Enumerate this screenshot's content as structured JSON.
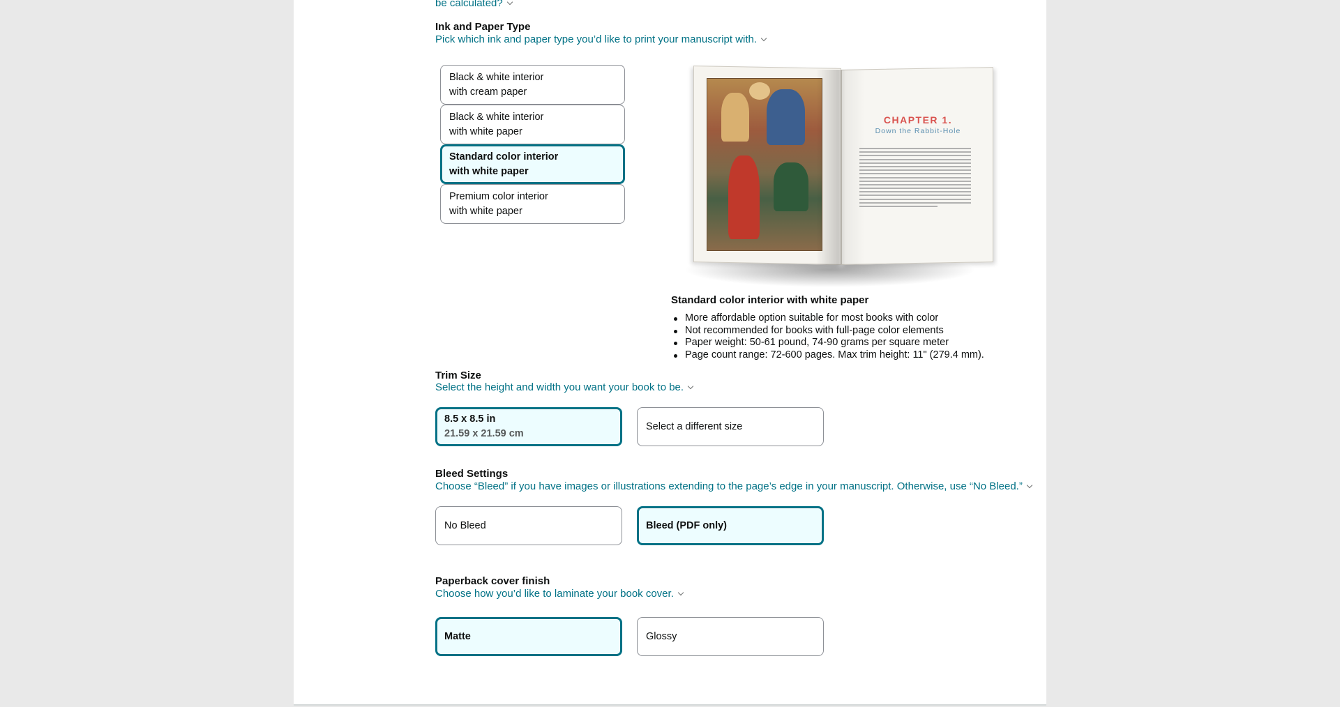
{
  "top_cut_link": "be calculated?",
  "ink_paper": {
    "title": "Ink and Paper Type",
    "description": "Pick which ink and paper type you’d like to print your manuscript with.",
    "options": [
      {
        "line1": "Black & white interior",
        "line2": "with cream paper",
        "selected": false
      },
      {
        "line1": "Black & white interior",
        "line2": "with white paper",
        "selected": false
      },
      {
        "line1": "Standard color interior",
        "line2": "with white paper",
        "selected": true
      },
      {
        "line1": "Premium color interior",
        "line2": "with white paper",
        "selected": false
      }
    ],
    "preview": {
      "chapter_title": "CHAPTER 1.",
      "chapter_subtitle": "Down the Rabbit-Hole"
    },
    "detail_title": "Standard color interior with white paper",
    "detail_bullets": [
      "More affordable option suitable for most books with color",
      "Not recommended for books with full-page color elements",
      "Paper weight: 50-61 pound, 74-90 grams per square meter",
      "Page count range: 72-600 pages. Max trim height: 11\" (279.4 mm)."
    ]
  },
  "trim_size": {
    "title": "Trim Size",
    "description": "Select the height and width you want your book to be.",
    "selected_option": {
      "line1": "8.5 x 8.5 in",
      "line2": "21.59 x 21.59 cm"
    },
    "other_option": "Select a different size"
  },
  "bleed": {
    "title": "Bleed Settings",
    "description": "Choose “Bleed” if you have images or illustrations extending to the page’s edge in your manuscript. Otherwise, use “No Bleed.”",
    "options": [
      {
        "label": "No Bleed",
        "selected": false
      },
      {
        "label": "Bleed (PDF only)",
        "selected": true
      }
    ]
  },
  "cover_finish": {
    "title": "Paperback cover finish",
    "description": "Choose how you’d like to laminate your book cover.",
    "options": [
      {
        "label": "Matte",
        "selected": true
      },
      {
        "label": "Glossy",
        "selected": false
      }
    ]
  },
  "colors": {
    "accent": "#007185",
    "selected_bg": "#edfdff",
    "page_bg": "#e9e9e9",
    "text": "#0f1111"
  }
}
